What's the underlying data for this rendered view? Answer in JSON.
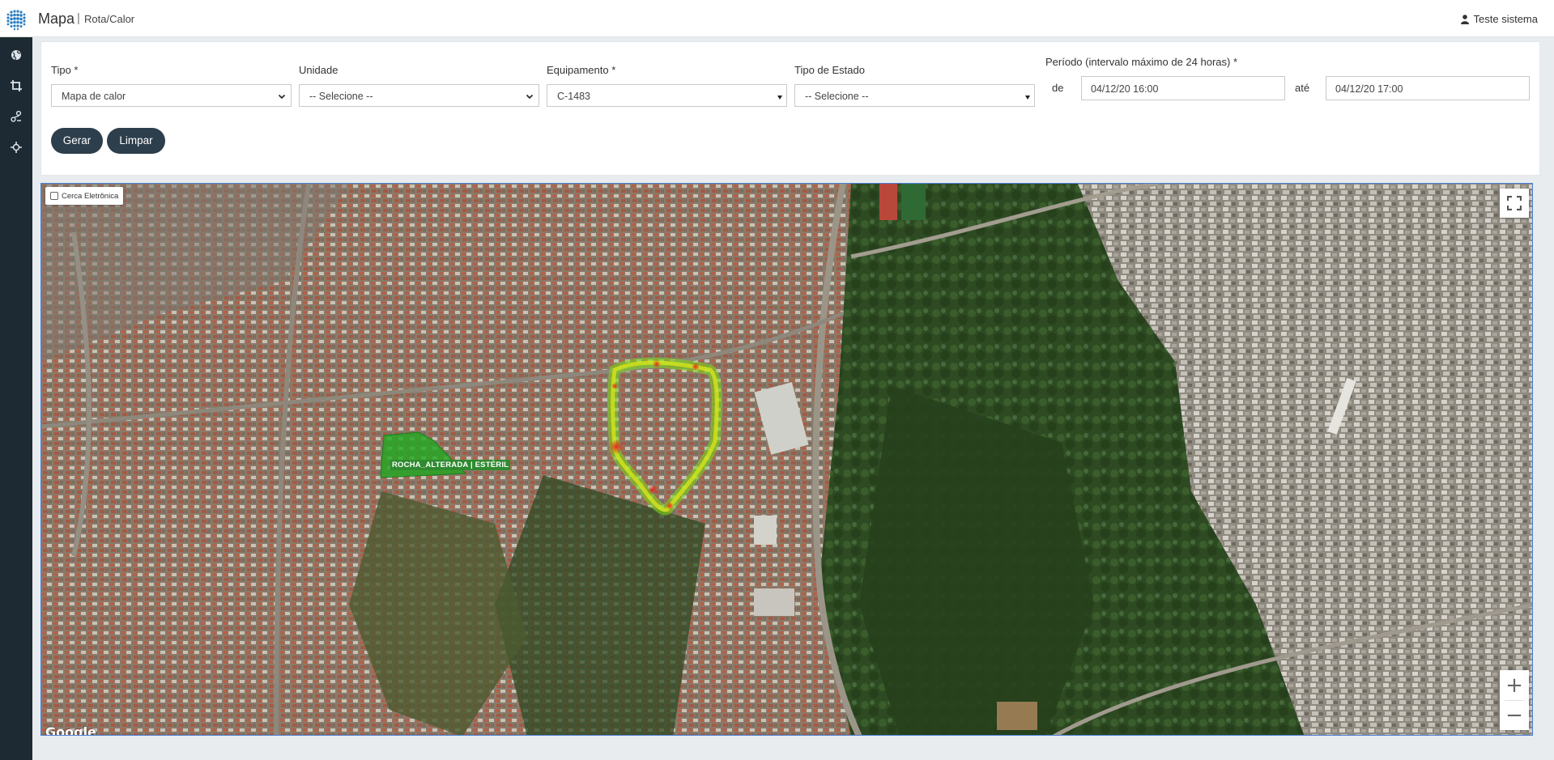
{
  "header": {
    "app_title": "Mapa",
    "separator": "|",
    "breadcrumb": "Rota/Calor",
    "user_name": "Teste sistema"
  },
  "sidebar": {
    "items": [
      {
        "icon": "globe-icon"
      },
      {
        "icon": "crop-icon"
      },
      {
        "icon": "route-icon"
      },
      {
        "icon": "crosshair-icon"
      }
    ]
  },
  "filters": {
    "tipo": {
      "label": "Tipo *",
      "value": "Mapa de calor"
    },
    "unidade": {
      "label": "Unidade",
      "value": "-- Selecione --"
    },
    "equipamento": {
      "label": "Equipamento *",
      "value": "C-1483"
    },
    "tipo_estado": {
      "label": "Tipo de Estado",
      "value": "-- Selecione --"
    },
    "periodo": {
      "label": "Período (intervalo máximo de 24 horas) *",
      "from_label": "de",
      "from_value": "04/12/20 16:00",
      "to_label": "até",
      "to_value": "04/12/20 17:00"
    },
    "buttons": {
      "generate": "Gerar",
      "clear": "Limpar"
    }
  },
  "map": {
    "fence_checkbox_label": "Cerca Eletrônica",
    "fence_checked": false,
    "fence_name": "ROCHA_ALTERADA | ESTÉRIL",
    "attribution": "Google",
    "zoom_in": "+",
    "zoom_out": "−",
    "colors": {
      "fence": "#22a822",
      "heat_low": "#7cd61a",
      "heat_high": "#e8271c",
      "accent": "#2d3e4c"
    }
  }
}
